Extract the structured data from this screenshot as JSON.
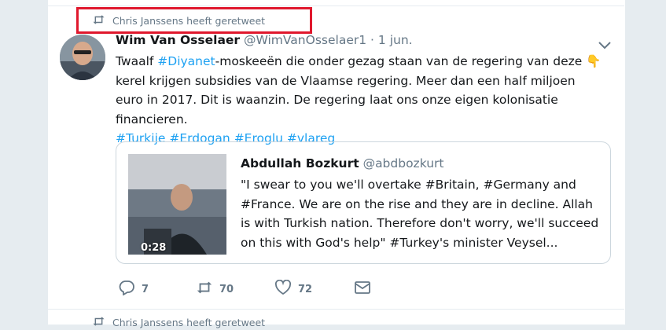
{
  "retweet_context": {
    "label": "Chris Janssens heeft geretweet"
  },
  "next_retweet_context": {
    "label": "Chris Janssens heeft geretweet"
  },
  "tweet": {
    "display_name": "Wim Van Osselaer",
    "handle": "@WimVanOsselaer1",
    "separator": "·",
    "date": "1 jun.",
    "text_parts": [
      "Twaalf ",
      "#Diyanet",
      "-moskeeën die onder gezag staan van de regering van deze ",
      "👇",
      " kerel krijgen subsidies van de Vlaamse regering. Meer dan een half miljoen euro in 2017. Dit is waanzin. De regering laat ons onze eigen kolonisatie financieren."
    ],
    "hashtags": [
      "#Turkije",
      "#Erdogan",
      "#Eroglu",
      "#vlareg"
    ]
  },
  "quoted": {
    "display_name": "Abdullah Bozkurt",
    "handle": "@abdbozkurt",
    "text": "\"I swear to you we'll overtake #Britain, #Germany and #France. We are on the rise and they are in decline. Allah is with Turkish nation. Therefore don't worry, we'll succeed on this with God's help\" #Turkey's minister Veysel...",
    "video_duration": "0:28"
  },
  "actions": {
    "reply_count": "7",
    "retweet_count": "70",
    "like_count": "72"
  },
  "colors": {
    "accent": "#1da1f2",
    "muted": "#657786",
    "highlight_box": "#e0182d"
  },
  "icons": [
    "retweet-icon",
    "reply-icon",
    "like-icon",
    "message-icon",
    "chevron-down-icon"
  ]
}
